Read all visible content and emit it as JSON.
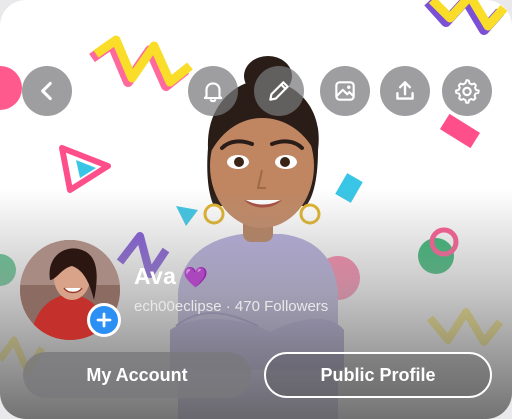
{
  "profile": {
    "display_name": "Ava",
    "badge_emoji": "💜",
    "username": "ech00eclipse",
    "separator": " · ",
    "followers": "470 Followers"
  },
  "buttons": {
    "my_account": "My Account",
    "public_profile": "Public Profile"
  },
  "top_actions": [
    "back-icon",
    "bell-icon",
    "pencil-icon",
    "gallery-icon",
    "share-icon",
    "gear-icon"
  ],
  "colors": {
    "accent_blue": "#2b8ff3",
    "button_gray": "#78787c",
    "confetti_yellow": "#f9dd28",
    "confetti_purple": "#7b4fd6",
    "confetti_pink": "#ff4f8b",
    "confetti_teal": "#39c6e6",
    "confetti_green": "#27b36a"
  }
}
